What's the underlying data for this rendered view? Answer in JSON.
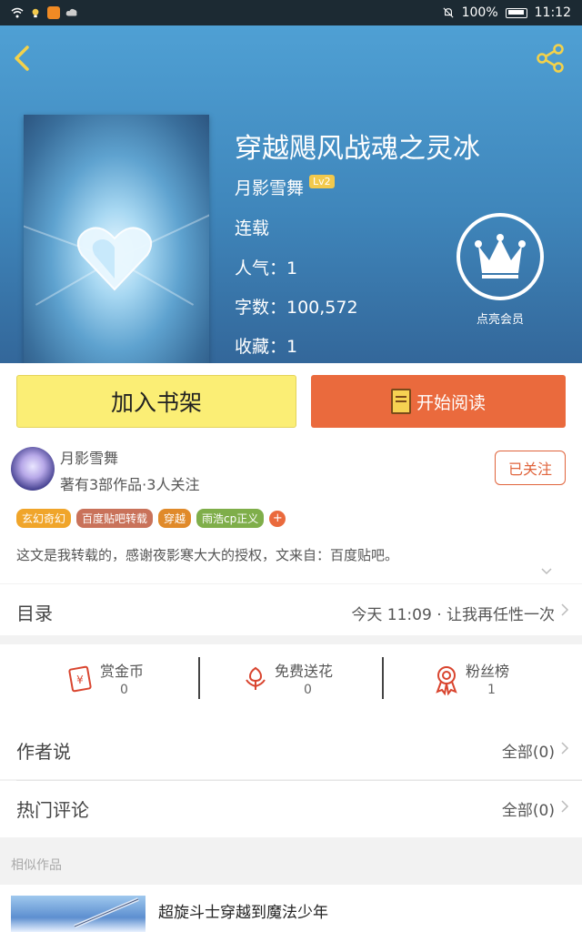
{
  "status_bar": {
    "battery": "100%",
    "time": "11:12"
  },
  "book": {
    "title": "穿越飓风战魂之灵冰",
    "author": "月影雪舞",
    "author_level": "Lv2",
    "status": "连载",
    "popularity": "人气：1",
    "word_count": "字数：100,572",
    "favorites": "收藏：1",
    "vip_label": "点亮会员"
  },
  "actions": {
    "add_shelf": "加入书架",
    "start_read": "开始阅读"
  },
  "author_card": {
    "name": "月影雪舞",
    "stats": "著有3部作品·3人关注",
    "follow_label": "已关注",
    "tags": [
      {
        "label": "玄幻奇幻",
        "color": "#f0a52a"
      },
      {
        "label": "百度贴吧转载",
        "color": "#c9725a"
      },
      {
        "label": "穿越",
        "color": "#e08a2a"
      },
      {
        "label": "雨浩cp正义",
        "color": "#7fae4a"
      }
    ],
    "tag_more": "+",
    "description": "这文是我转载的，感谢夜影寒大大的授权，文来自：百度贴吧。"
  },
  "toc": {
    "title": "目录",
    "latest": "今天 11:09 · 让我再任性一次"
  },
  "stats": [
    {
      "label": "赏金币",
      "value": "0",
      "icon": "reward-coin-icon"
    },
    {
      "label": "免费送花",
      "value": "0",
      "icon": "flower-icon"
    },
    {
      "label": "粉丝榜",
      "value": "1",
      "icon": "medal-icon"
    }
  ],
  "author_says": {
    "title": "作者说",
    "count": "全部(0)"
  },
  "hot_comments": {
    "title": "热门评论",
    "count": "全部(0)"
  },
  "similar": {
    "section_label": "相似作品",
    "first_title": "超旋斗士穿越到魔法少年"
  },
  "colors": {
    "accent_orange": "#ea6a3d",
    "shelf_yellow": "#fbee75",
    "hero_blue": "#3f86bb"
  }
}
